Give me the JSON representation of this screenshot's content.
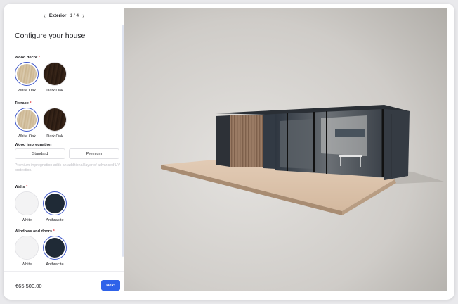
{
  "stepper": {
    "step_name": "Exterior",
    "step_count": "1 / 4"
  },
  "title": "Configure your house",
  "sections": {
    "wood_decor": {
      "label": "Wood decor",
      "required": "*",
      "options": [
        {
          "label": "White Oak",
          "color": "#d6c3a2",
          "selected": true
        },
        {
          "label": "Dark Oak",
          "color": "#2b1c13",
          "selected": false
        }
      ]
    },
    "terrace": {
      "label": "Terrace",
      "required": "*",
      "options": [
        {
          "label": "White Oak",
          "color": "#d6c3a2",
          "selected": true
        },
        {
          "label": "Dark Oak",
          "color": "#2b1c13",
          "selected": false
        }
      ]
    },
    "wood_impregnation": {
      "label": "Wood impregnation",
      "options": [
        {
          "label": "Standard"
        },
        {
          "label": "Premium"
        }
      ],
      "hint": "Premium impregnation adds an additional layer of advanced UV protection."
    },
    "walls": {
      "label": "Walls",
      "required": "*",
      "options": [
        {
          "label": "White",
          "color": "#f3f3f4",
          "selected": false
        },
        {
          "label": "Anthracite",
          "color": "#1f2a36",
          "selected": true
        }
      ]
    },
    "windows_doors": {
      "label": "Windows and doors",
      "required": "*",
      "options": [
        {
          "label": "White",
          "color": "#f3f3f4",
          "selected": false
        },
        {
          "label": "Anthracite",
          "color": "#1f2a36",
          "selected": true
        }
      ]
    }
  },
  "footer": {
    "price": "€65,500.00",
    "next_label": "Next"
  },
  "colors": {
    "accent": "#2f62e9",
    "selection_ring": "#3d56c9",
    "required": "#e5484d"
  },
  "icons": {
    "prev": "chevron-left-icon",
    "next": "chevron-right-icon"
  }
}
